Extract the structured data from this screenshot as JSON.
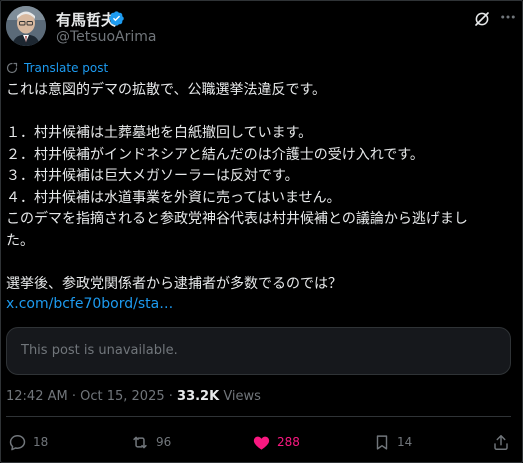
{
  "author": {
    "display_name": "有馬哲夫",
    "handle": "@TetsuoArima",
    "verified": true
  },
  "header_icons": [
    "grok-icon",
    "more-icon"
  ],
  "translate_label": "Translate post",
  "body_lines": [
    "これは意図的デマの拡散で、公職選挙法違反です。",
    "",
    "１．村井候補は土葬墓地を白紙撤回しています。",
    "２．村井候補がインドネシアと結んだのは介護士の受け入れです。",
    "３．村井候補は巨大メガソーラーは反対です。",
    "４．村井候補は水道事業を外資に売ってはいません。",
    "このデマを指摘されると参政党神谷代表は村井候補との議論から逃げまし",
    "た。",
    "",
    "選挙後、参政党関係者から逮捕者が多数でるのでは？"
  ],
  "link_text": "x.com/bcfe70bord/sta…",
  "quoted_post": {
    "text": "This post is unavailable."
  },
  "meta": {
    "time": "12:42 AM",
    "separator1": " · ",
    "date": "Oct 15, 2025",
    "separator2": " · ",
    "views_count": "33.2K",
    "views_label": " Views"
  },
  "actions": {
    "reply_count": "18",
    "repost_count": "96",
    "like_count": "288",
    "bookmark_count": "14"
  },
  "colors": {
    "background": "#000000",
    "text": "#e7e9ea",
    "secondary": "#71767b",
    "link": "#1d9bf0",
    "like": "#f91880",
    "border": "#2f3336"
  }
}
